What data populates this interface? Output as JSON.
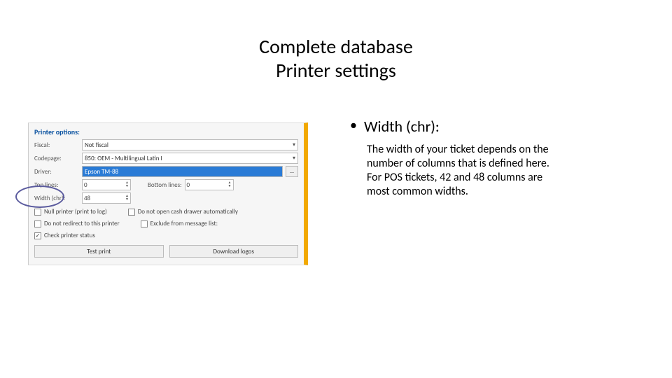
{
  "slide": {
    "title_line1": "Complete database",
    "title_line2": "Printer settings"
  },
  "panel": {
    "header": "Printer options:",
    "fields": {
      "fiscal_label": "Fiscal:",
      "fiscal_value": "Not fiscal",
      "codepage_label": "Codepage:",
      "codepage_value": "850: OEM - Multilingual Latin I",
      "driver_label": "Driver:",
      "driver_value": "Epson TM-88",
      "toplines_label": "Top lines:",
      "toplines_value": "0",
      "bottomlines_label": "Bottom lines:",
      "bottomlines_value": "0",
      "width_label": "Width (chr):",
      "width_value": "48"
    },
    "checks": {
      "null_printer": "Null printer (print to log)",
      "no_cash_drawer": "Do not open cash drawer automatically",
      "no_redirect": "Do not redirect to this printer",
      "exclude_msg": "Exclude from message list:",
      "check_status": "Check printer status"
    },
    "buttons": {
      "test_print": "Test print",
      "download_logos": "Download logos"
    },
    "ellipsis": "..."
  },
  "right": {
    "bullet": "Width (chr):",
    "desc": "The width of your ticket depends on the number of columns that is defined here. For POS tickets, 42 and 48 columns are most common widths."
  }
}
